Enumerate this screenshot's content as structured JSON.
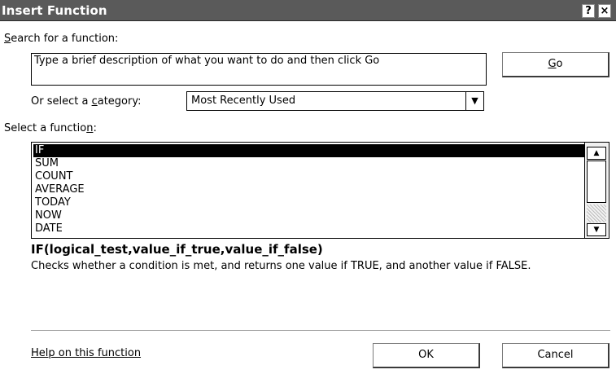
{
  "window": {
    "title": "Insert Function",
    "help_button": "?",
    "close_button": "×"
  },
  "search": {
    "label_prefix": "",
    "label_key": "S",
    "label_rest": "earch for a function:",
    "value": "Type a brief description of what you want to do and then click Go",
    "go_prefix": "",
    "go_key": "G",
    "go_rest": "o"
  },
  "category": {
    "label_prefix": "Or select a ",
    "label_key": "c",
    "label_rest": "ategory:",
    "selected": "Most Recently Used",
    "arrow": "▼"
  },
  "functions": {
    "label_prefix": "Select a functio",
    "label_key": "n",
    "label_rest": ":",
    "items": [
      "IF",
      "SUM",
      "COUNT",
      "AVERAGE",
      "TODAY",
      "NOW",
      "DATE"
    ],
    "selected_index": 0,
    "scroll_up": "▲",
    "scroll_down": "▼"
  },
  "details": {
    "signature": "IF(logical_test,value_if_true,value_if_false)",
    "description": "Checks whether a condition is met, and returns one value if TRUE, and another value if FALSE."
  },
  "footer": {
    "help_link": "Help on this function",
    "ok_label": "OK",
    "cancel_label": "Cancel"
  },
  "colors": {
    "titlebar": "#5a5a5a",
    "selection": "#000000",
    "background": "#ffffff"
  }
}
